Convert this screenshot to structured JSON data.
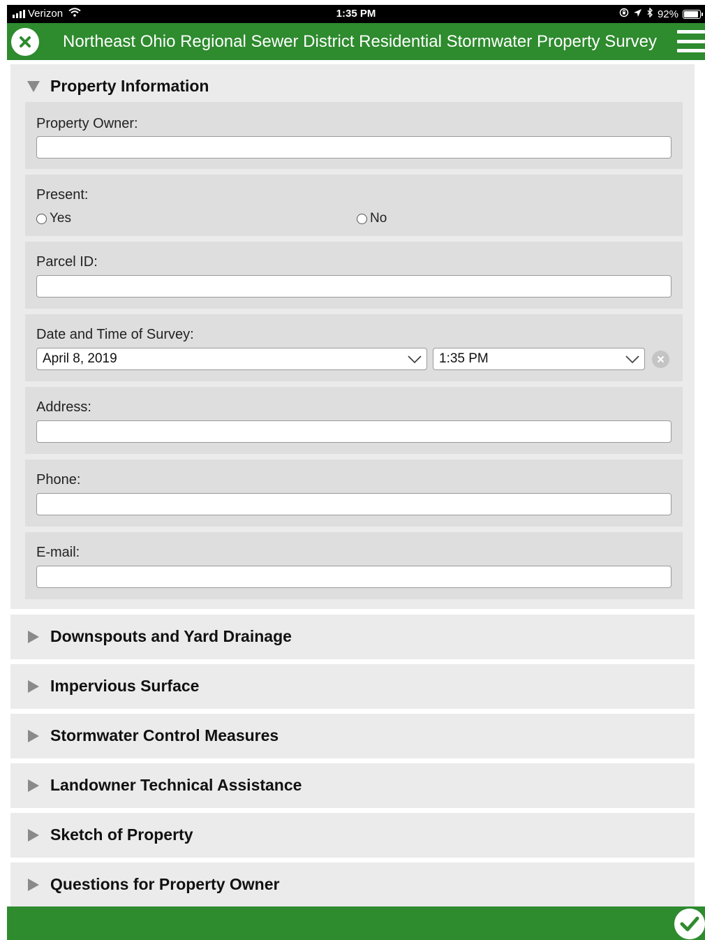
{
  "status_bar": {
    "carrier": "Verizon",
    "time": "1:35 PM",
    "battery": "92%",
    "battery_level": 0.92,
    "icons": [
      "signal-icon",
      "wifi-icon",
      "orientation-lock-icon",
      "location-icon",
      "bluetooth-icon",
      "battery-icon"
    ]
  },
  "header": {
    "title": "Northeast Ohio Regional Sewer District Residential Stormwater Property Survey",
    "close_icon": "close-icon",
    "menu_icon": "menu-icon"
  },
  "colors": {
    "brand_green": "#2e8b2e",
    "section_bg": "#ebebeb",
    "field_bg": "#dedede"
  },
  "property_section": {
    "title": "Property Information",
    "expanded": true,
    "fields": {
      "owner": {
        "label": "Property Owner:",
        "value": ""
      },
      "present": {
        "label": "Present:",
        "options": [
          "Yes",
          "No"
        ]
      },
      "parcel": {
        "label": "Parcel ID:",
        "value": ""
      },
      "datetime": {
        "label": "Date and Time of Survey:",
        "date": "April 8, 2019",
        "time": "1:35 PM"
      },
      "address": {
        "label": "Address:",
        "value": ""
      },
      "phone": {
        "label": "Phone:",
        "value": ""
      },
      "email": {
        "label": "E-mail:",
        "value": ""
      }
    }
  },
  "collapsed_sections": [
    "Downspouts and Yard Drainage",
    "Impervious Surface",
    "Stormwater Control Measures",
    "Landowner Technical Assistance",
    "Sketch of Property",
    "Questions for Property Owner"
  ],
  "footer": {
    "submit_icon": "checkmark-icon"
  }
}
